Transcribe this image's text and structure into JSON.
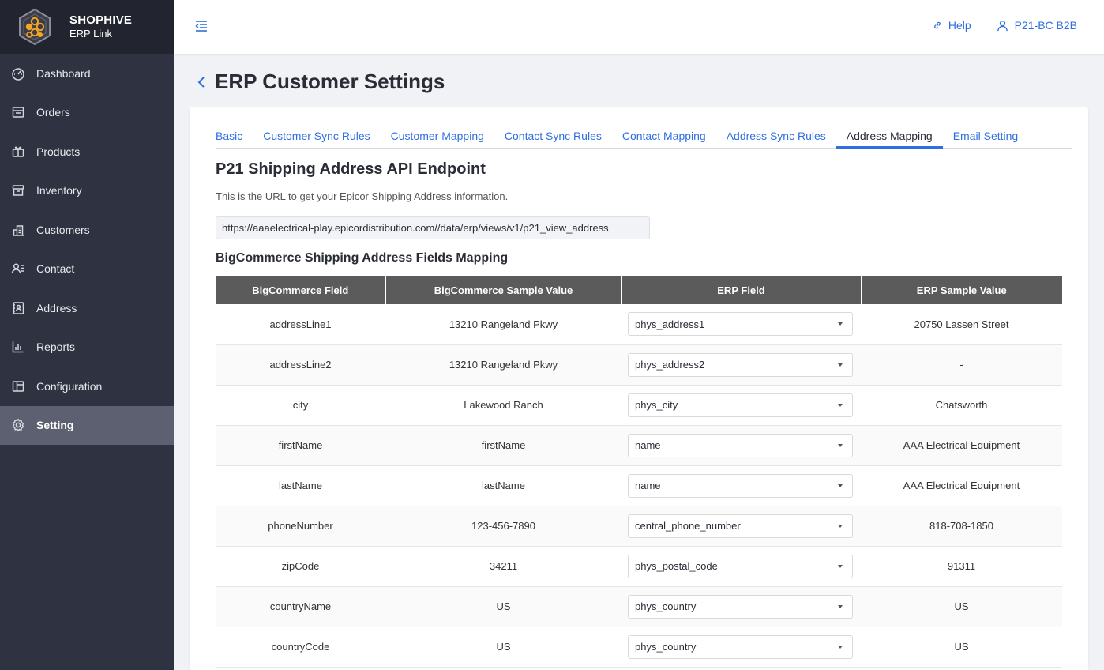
{
  "brand": {
    "name": "SHOPHIVE",
    "sub": "ERP Link"
  },
  "sidebar": {
    "items": [
      {
        "label": "Dashboard",
        "icon": "dashboard-icon"
      },
      {
        "label": "Orders",
        "icon": "orders-icon"
      },
      {
        "label": "Products",
        "icon": "products-icon"
      },
      {
        "label": "Inventory",
        "icon": "inventory-icon"
      },
      {
        "label": "Customers",
        "icon": "customers-icon"
      },
      {
        "label": "Contact",
        "icon": "contact-icon"
      },
      {
        "label": "Address",
        "icon": "address-icon"
      },
      {
        "label": "Reports",
        "icon": "reports-icon"
      },
      {
        "label": "Configuration",
        "icon": "configuration-icon"
      },
      {
        "label": "Setting",
        "icon": "setting-icon",
        "active": true
      }
    ]
  },
  "header": {
    "help": "Help",
    "user": "P21-BC B2B"
  },
  "page": {
    "title": "ERP Customer Settings"
  },
  "tabs": [
    {
      "label": "Basic"
    },
    {
      "label": "Customer Sync Rules"
    },
    {
      "label": "Customer Mapping"
    },
    {
      "label": "Contact Sync Rules"
    },
    {
      "label": "Contact Mapping"
    },
    {
      "label": "Address Sync Rules"
    },
    {
      "label": "Address Mapping",
      "active": true
    },
    {
      "label": "Email Setting"
    }
  ],
  "section": {
    "title": "P21 Shipping Address API Endpoint",
    "description": "This is the URL to get your Epicor Shipping Address information.",
    "endpoint": "https://aaaelectrical-play.epicordistribution.com//data/erp/views/v1/p21_view_address"
  },
  "mapping": {
    "title": "BigCommerce Shipping Address Fields Mapping",
    "headers": [
      "BigCommerce Field",
      "BigCommerce Sample Value",
      "ERP Field",
      "ERP Sample Value"
    ],
    "rows": [
      {
        "bc_field": "addressLine1",
        "bc_sample": "13210 Rangeland Pkwy",
        "erp_field": "phys_address1",
        "erp_sample": "20750 Lassen Street"
      },
      {
        "bc_field": "addressLine2",
        "bc_sample": "13210 Rangeland Pkwy",
        "erp_field": "phys_address2",
        "erp_sample": "-"
      },
      {
        "bc_field": "city",
        "bc_sample": "Lakewood Ranch",
        "erp_field": "phys_city",
        "erp_sample": "Chatsworth"
      },
      {
        "bc_field": "firstName",
        "bc_sample": "firstName",
        "erp_field": "name",
        "erp_sample": "AAA Electrical Equipment"
      },
      {
        "bc_field": "lastName",
        "bc_sample": "lastName",
        "erp_field": "name",
        "erp_sample": "AAA Electrical Equipment"
      },
      {
        "bc_field": "phoneNumber",
        "bc_sample": "123-456-7890",
        "erp_field": "central_phone_number",
        "erp_sample": "818-708-1850"
      },
      {
        "bc_field": "zipCode",
        "bc_sample": "34211",
        "erp_field": "phys_postal_code",
        "erp_sample": "91311"
      },
      {
        "bc_field": "countryName",
        "bc_sample": "US",
        "erp_field": "phys_country",
        "erp_sample": "US"
      },
      {
        "bc_field": "countryCode",
        "bc_sample": "US",
        "erp_field": "phys_country",
        "erp_sample": "US"
      }
    ]
  },
  "colors": {
    "accent": "#2f6fe0",
    "sidebar": "#2f3240",
    "sidebar_active": "#5d6071",
    "table_header": "#5b5b5b"
  }
}
